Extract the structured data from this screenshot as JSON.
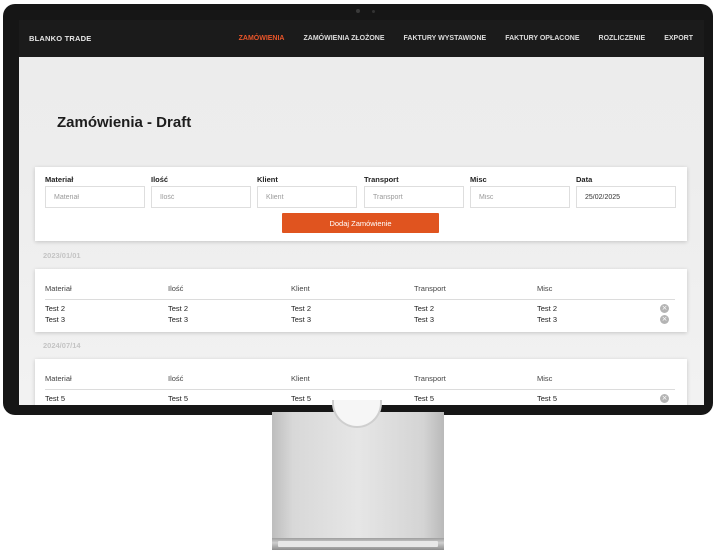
{
  "nav": {
    "brand": "BLANKO TRADE",
    "links": [
      {
        "label": "ZAMÓWIENIA",
        "active": true
      },
      {
        "label": "ZAMÓWIENIA ZŁOŻONE",
        "active": false
      },
      {
        "label": "FAKTURY WYSTAWIONE",
        "active": false
      },
      {
        "label": "FAKTURY OPŁACONE",
        "active": false
      },
      {
        "label": "ROZLICZENIE",
        "active": false
      },
      {
        "label": "EXPORT",
        "active": false
      }
    ]
  },
  "page": {
    "title": "Zamówienia - Draft"
  },
  "form": {
    "fields": [
      {
        "label": "Materiał",
        "placeholder": "Materiał",
        "value": ""
      },
      {
        "label": "Ilość",
        "placeholder": "Ilość",
        "value": ""
      },
      {
        "label": "Klient",
        "placeholder": "Klient",
        "value": ""
      },
      {
        "label": "Transport",
        "placeholder": "Transport",
        "value": ""
      },
      {
        "label": "Misc",
        "placeholder": "Misc",
        "value": ""
      },
      {
        "label": "Data",
        "placeholder": "",
        "value": "25/02/2025"
      }
    ],
    "submit_label": "Dodaj Zamówienie"
  },
  "columns": [
    "Materiał",
    "Ilość",
    "Klient",
    "Transport",
    "Misc"
  ],
  "groups": [
    {
      "date": "2023/01/01",
      "rows": [
        [
          "Test 2",
          "Test 2",
          "Test 2",
          "Test 2",
          "Test 2"
        ],
        [
          "Test 3",
          "Test 3",
          "Test 3",
          "Test 3",
          "Test 3"
        ]
      ]
    },
    {
      "date": "2024/07/14",
      "rows": [
        [
          "Test 5",
          "Test 5",
          "Test 5",
          "Test 5",
          "Test 5"
        ]
      ]
    }
  ],
  "icons": {
    "remove": "remove-circle-icon"
  },
  "colors": {
    "accent": "#e0541f",
    "nav_bg": "#1b1b1b",
    "active_link": "#e8552a"
  }
}
